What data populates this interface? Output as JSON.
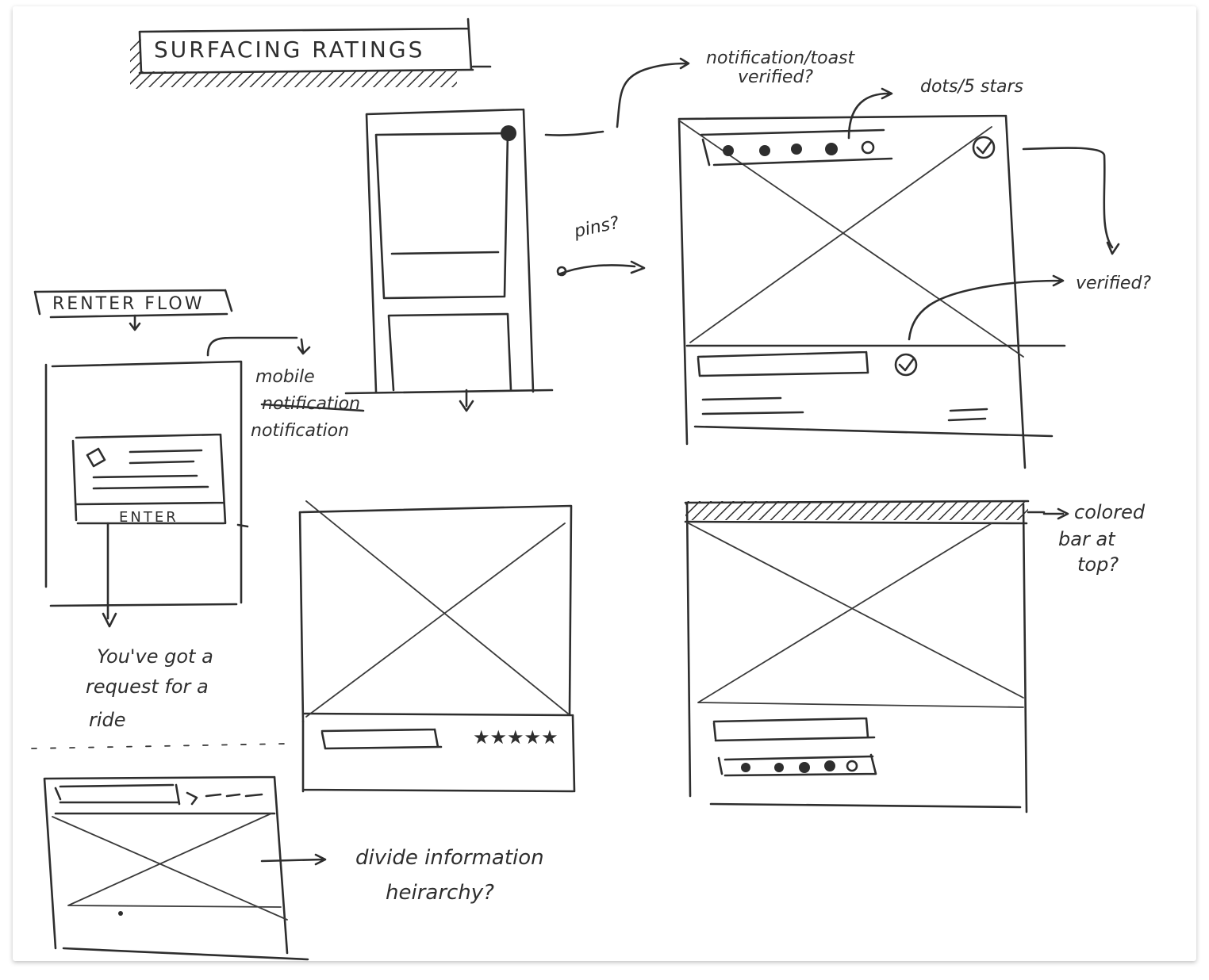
{
  "title": "SURFACING RATINGS",
  "flow_label": "RENTER FLOW",
  "enter_button": "ENTER",
  "annotations": {
    "notification_toast": "notification/toast",
    "verified_q_top": "verified?",
    "dots_stars": "dots/5 stars",
    "pins": "pins?",
    "verified_q_right": "verified?",
    "mobile": "mobile",
    "notification_struck": "notification",
    "notification": "notification",
    "request_line1": "You've got a",
    "request_line2": "request for a",
    "request_line3": "ride",
    "colored_bar_line1": "colored",
    "colored_bar_line2": "bar at",
    "colored_bar_line3": "top?",
    "divide_line1": "divide information",
    "divide_line2": "heirarchy?"
  },
  "colors": {
    "ink": "#2e2e2e",
    "paper": "#ffffff"
  }
}
